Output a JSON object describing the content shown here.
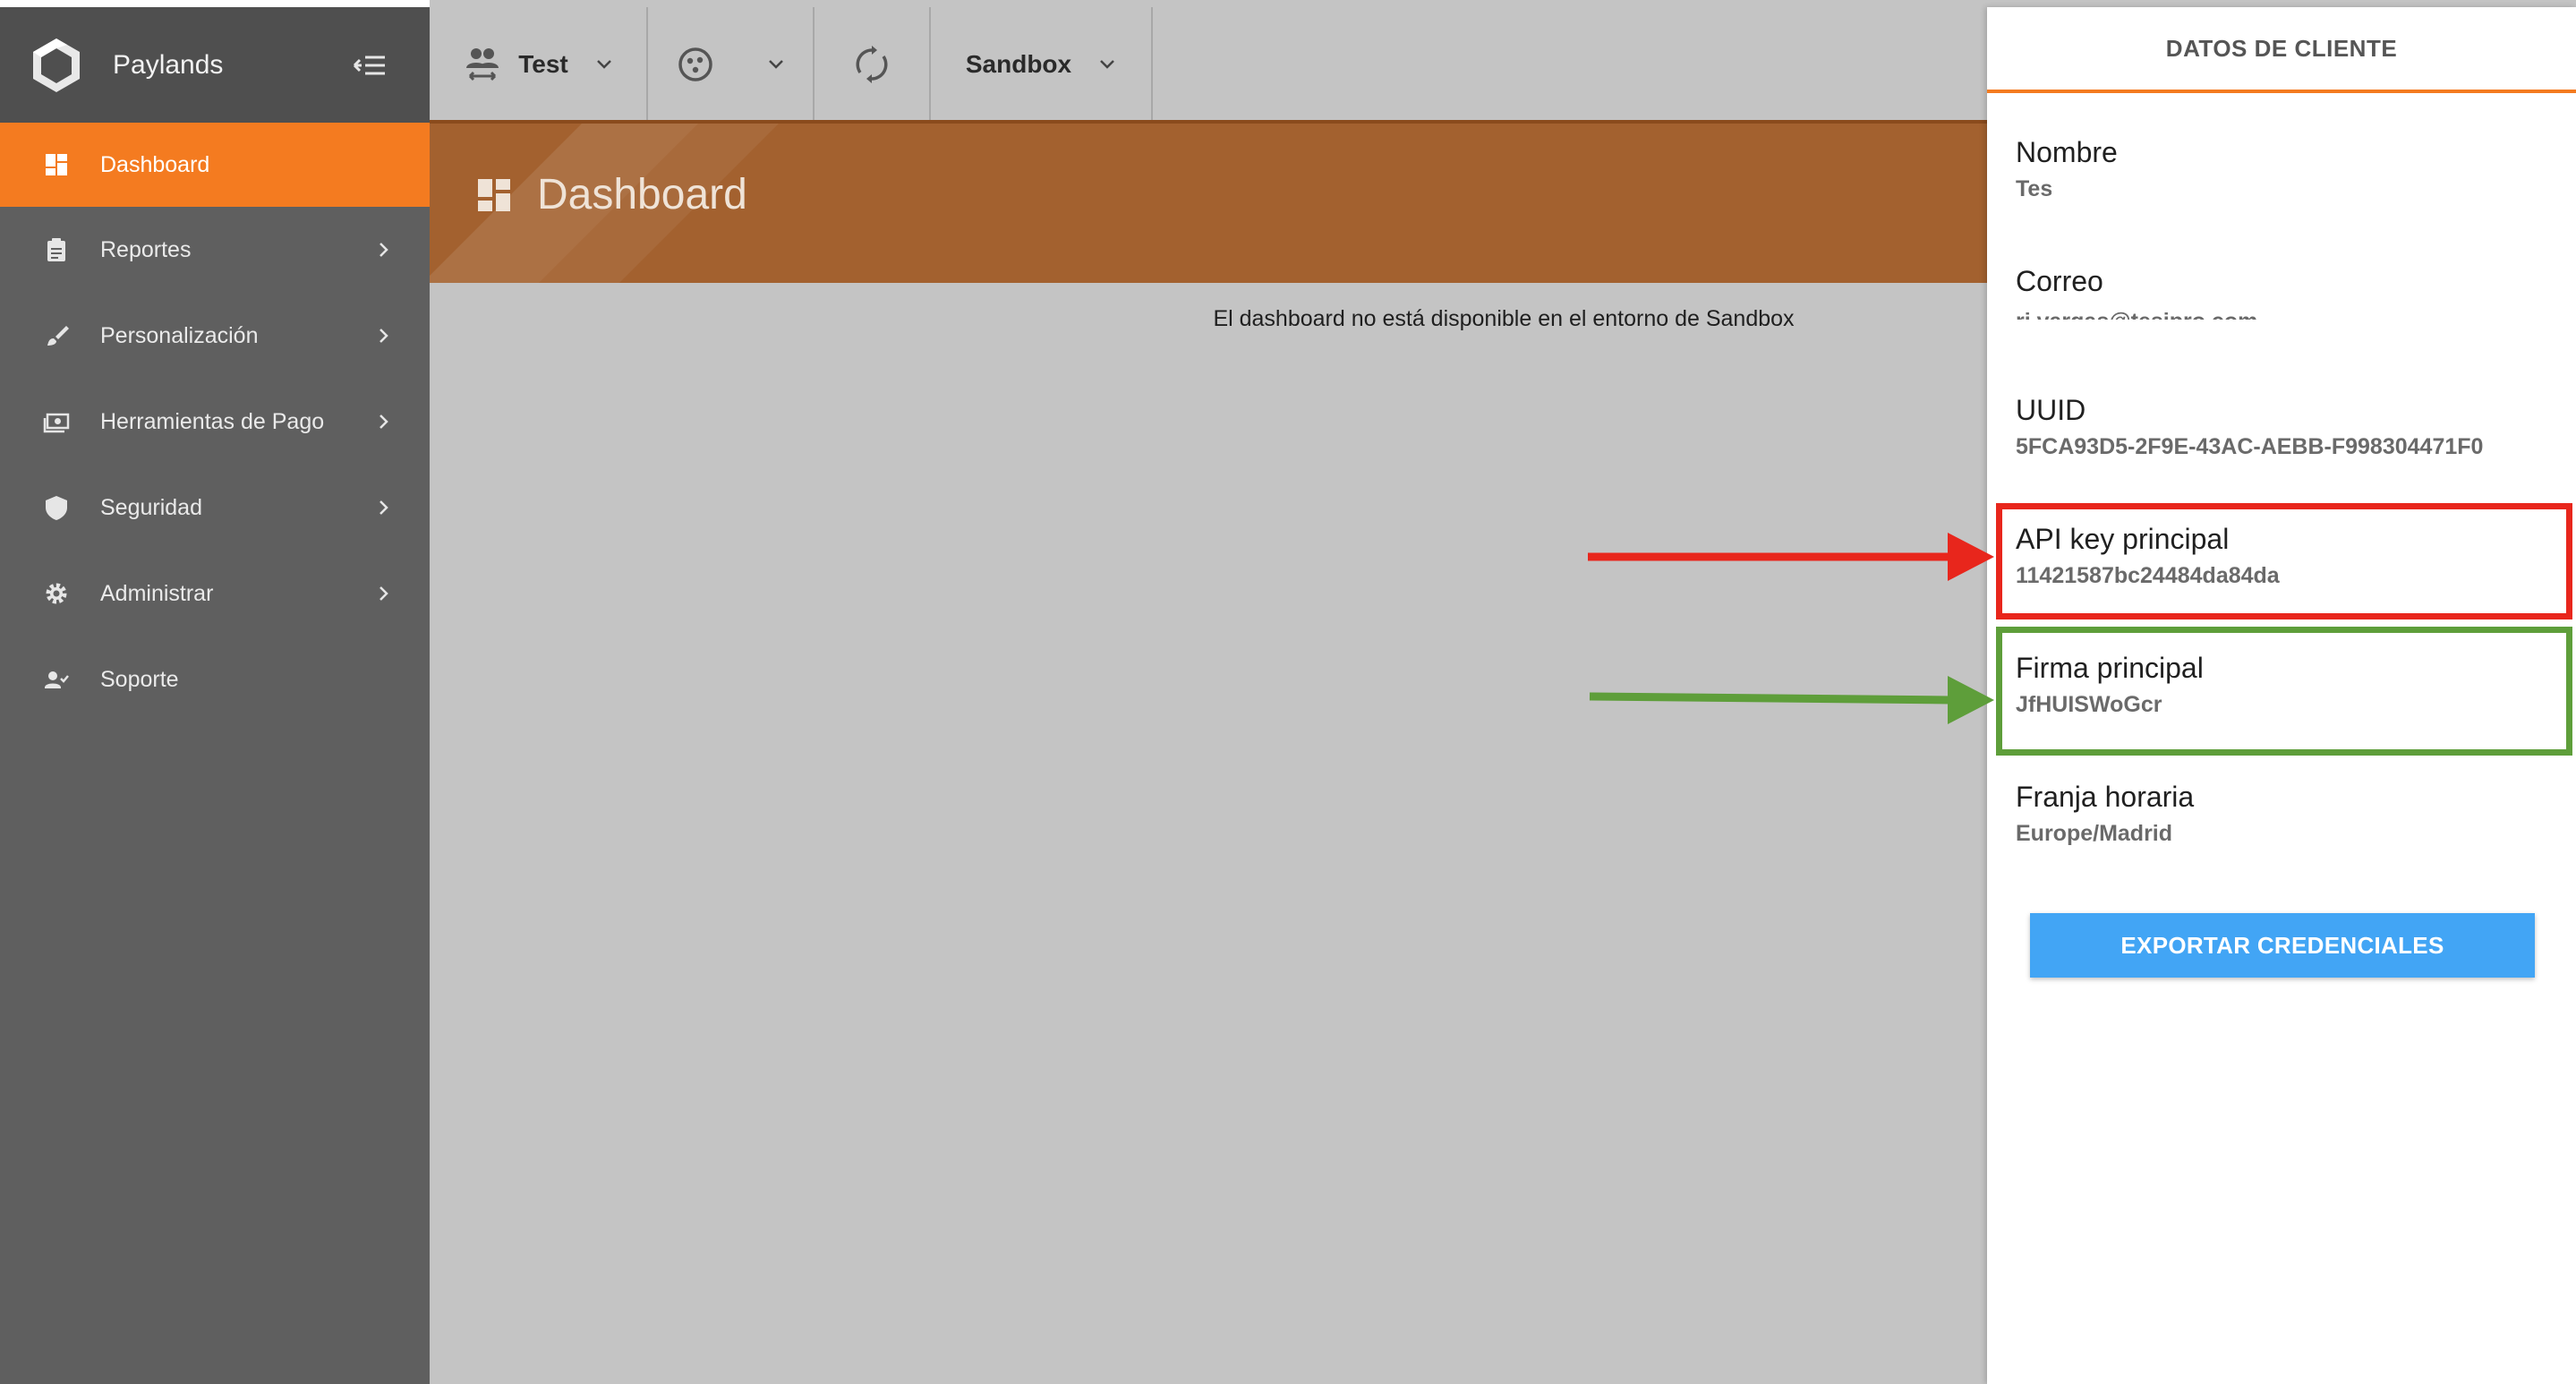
{
  "sidebar": {
    "app_title": "Paylands",
    "items": [
      {
        "label": "Dashboard",
        "active": true
      },
      {
        "label": "Reportes"
      },
      {
        "label": "Personalización"
      },
      {
        "label": "Herramientas de Pago"
      },
      {
        "label": "Seguridad"
      },
      {
        "label": "Administrar"
      },
      {
        "label": "Soporte"
      }
    ]
  },
  "topbar": {
    "account_label": "Test",
    "environment_label": "Sandbox"
  },
  "banner": {
    "title": "Dashboard"
  },
  "main": {
    "notice": "El dashboard no está disponible en el entorno de Sandbox"
  },
  "panel": {
    "title": "DATOS DE CLIENTE",
    "fields": [
      {
        "label": "Nombre",
        "value": "Tes"
      },
      {
        "label": "Correo",
        "value": "rj.vargas@tesipro.com"
      },
      {
        "label": "UUID",
        "value": "5FCA93D5-2F9E-43AC-AEBB-F998304471F0"
      },
      {
        "label": "API key principal",
        "value": "11421587bc24484da84da"
      },
      {
        "label": "Firma principal",
        "value": "JfHUISWoGcr"
      },
      {
        "label": "Franja horaria",
        "value": "Europe/Madrid"
      }
    ],
    "export_label": "EXPORTAR CREDENCIALES"
  },
  "colors": {
    "accent": "#f47b20",
    "banner": "#a3612f",
    "sidebar": "#5f5f5f",
    "button": "#42a5f5",
    "highlight_red": "#e8261c",
    "highlight_green": "#5e9e3a"
  }
}
